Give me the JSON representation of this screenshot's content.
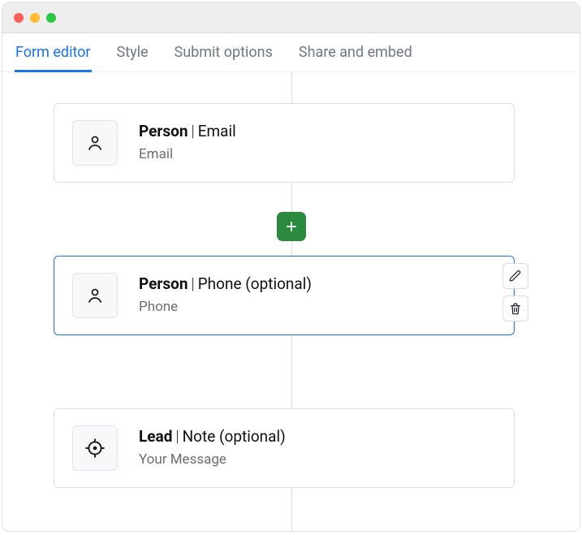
{
  "tabs": [
    {
      "label": "Form editor",
      "active": true
    },
    {
      "label": "Style",
      "active": false
    },
    {
      "label": "Submit options",
      "active": false
    },
    {
      "label": "Share and embed",
      "active": false
    }
  ],
  "cards": {
    "c1": {
      "entity": "Person",
      "field": "Email",
      "sub": "Email"
    },
    "c2": {
      "entity": "Person",
      "field": "Phone (optional)",
      "sub": "Phone"
    },
    "c3": {
      "entity": "Lead",
      "field": "Note (optional)",
      "sub": "Your Message"
    }
  },
  "icons": {
    "person": "person-icon",
    "lead": "target-icon",
    "add": "plus-icon",
    "edit": "pencil-icon",
    "delete": "trash-icon"
  },
  "colors": {
    "accent": "#1a73e8",
    "add_button": "#2a8a3e"
  }
}
